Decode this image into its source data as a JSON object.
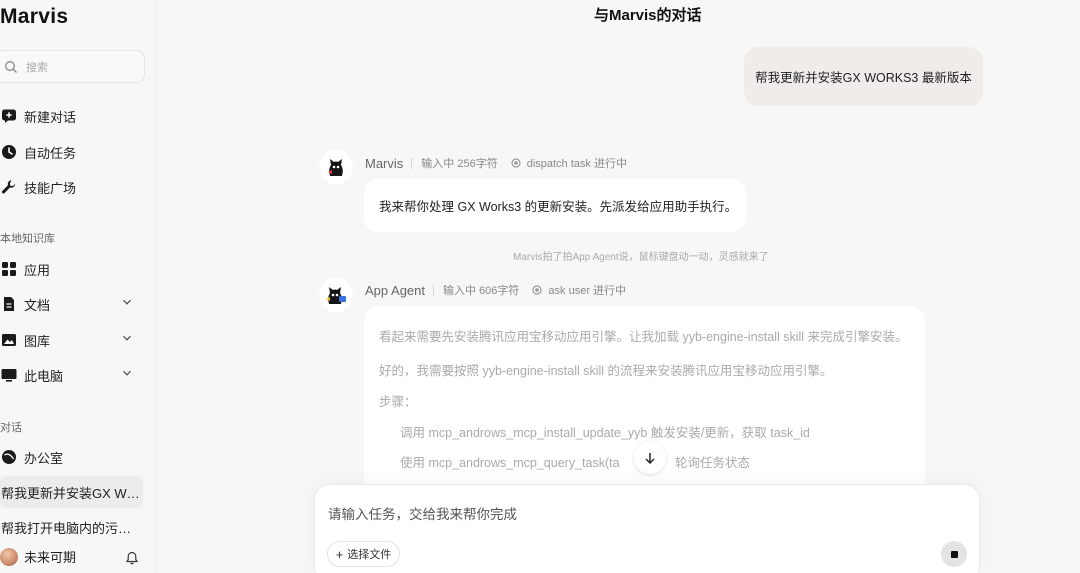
{
  "sidebar": {
    "logo": "Marvis",
    "search_placeholder": "搜索",
    "nav": [
      {
        "label": "新建对话",
        "icon": "new-chat-icon"
      },
      {
        "label": "自动任务",
        "icon": "clock-icon"
      },
      {
        "label": "技能广场",
        "icon": "wrench-icon"
      }
    ],
    "knowledge_section": "本地知识库",
    "knowledge": [
      {
        "label": "应用",
        "icon": "apps-grid-icon"
      },
      {
        "label": "文档",
        "icon": "document-icon"
      },
      {
        "label": "图库",
        "icon": "gallery-icon"
      },
      {
        "label": "此电脑",
        "icon": "monitor-icon"
      }
    ],
    "conversations_section": "对话",
    "office": {
      "label": "办公室",
      "icon": "office-icon"
    },
    "conversations": [
      {
        "label": "帮我更新并安装GX W…",
        "active": true
      },
      {
        "label": "帮我打开电脑内的污…",
        "active": false
      }
    ],
    "user_name": "未来可期"
  },
  "main": {
    "title": "与Marvis的对话",
    "user_message": "帮我更新并安装GX WORKS3 最新版本",
    "marvis": {
      "name": "Marvis",
      "typing": "输入中 256字符",
      "task": "dispatch task 进行中",
      "message": "我来帮你处理 GX Works3 的更新安装。先派发给应用助手执行。"
    },
    "notice": "Marvis拍了拍App Agent说，鼠标键盘动一动，灵感就来了",
    "agent": {
      "name": "App Agent",
      "typing": "输入中 606字符",
      "task": "ask user 进行中",
      "lines": [
        "看起来需要先安装腾讯应用宝移动应用引擎。让我加载 yyb-engine-install skill 来完成引擎安装。",
        "好的，我需要按照 yyb-engine-install skill 的流程来安装腾讯应用宝移动应用引擎。",
        "步骤：",
        "调用   mcp_androws_mcp_install_update_yyb  触发安装/更新，获取 task_id",
        "使用   mcp_androws_mcp_query_task(ta",
        "轮询任务状态"
      ]
    },
    "composer": {
      "placeholder": "请输入任务，交给我来帮你完成",
      "file_button": "选择文件"
    }
  }
}
